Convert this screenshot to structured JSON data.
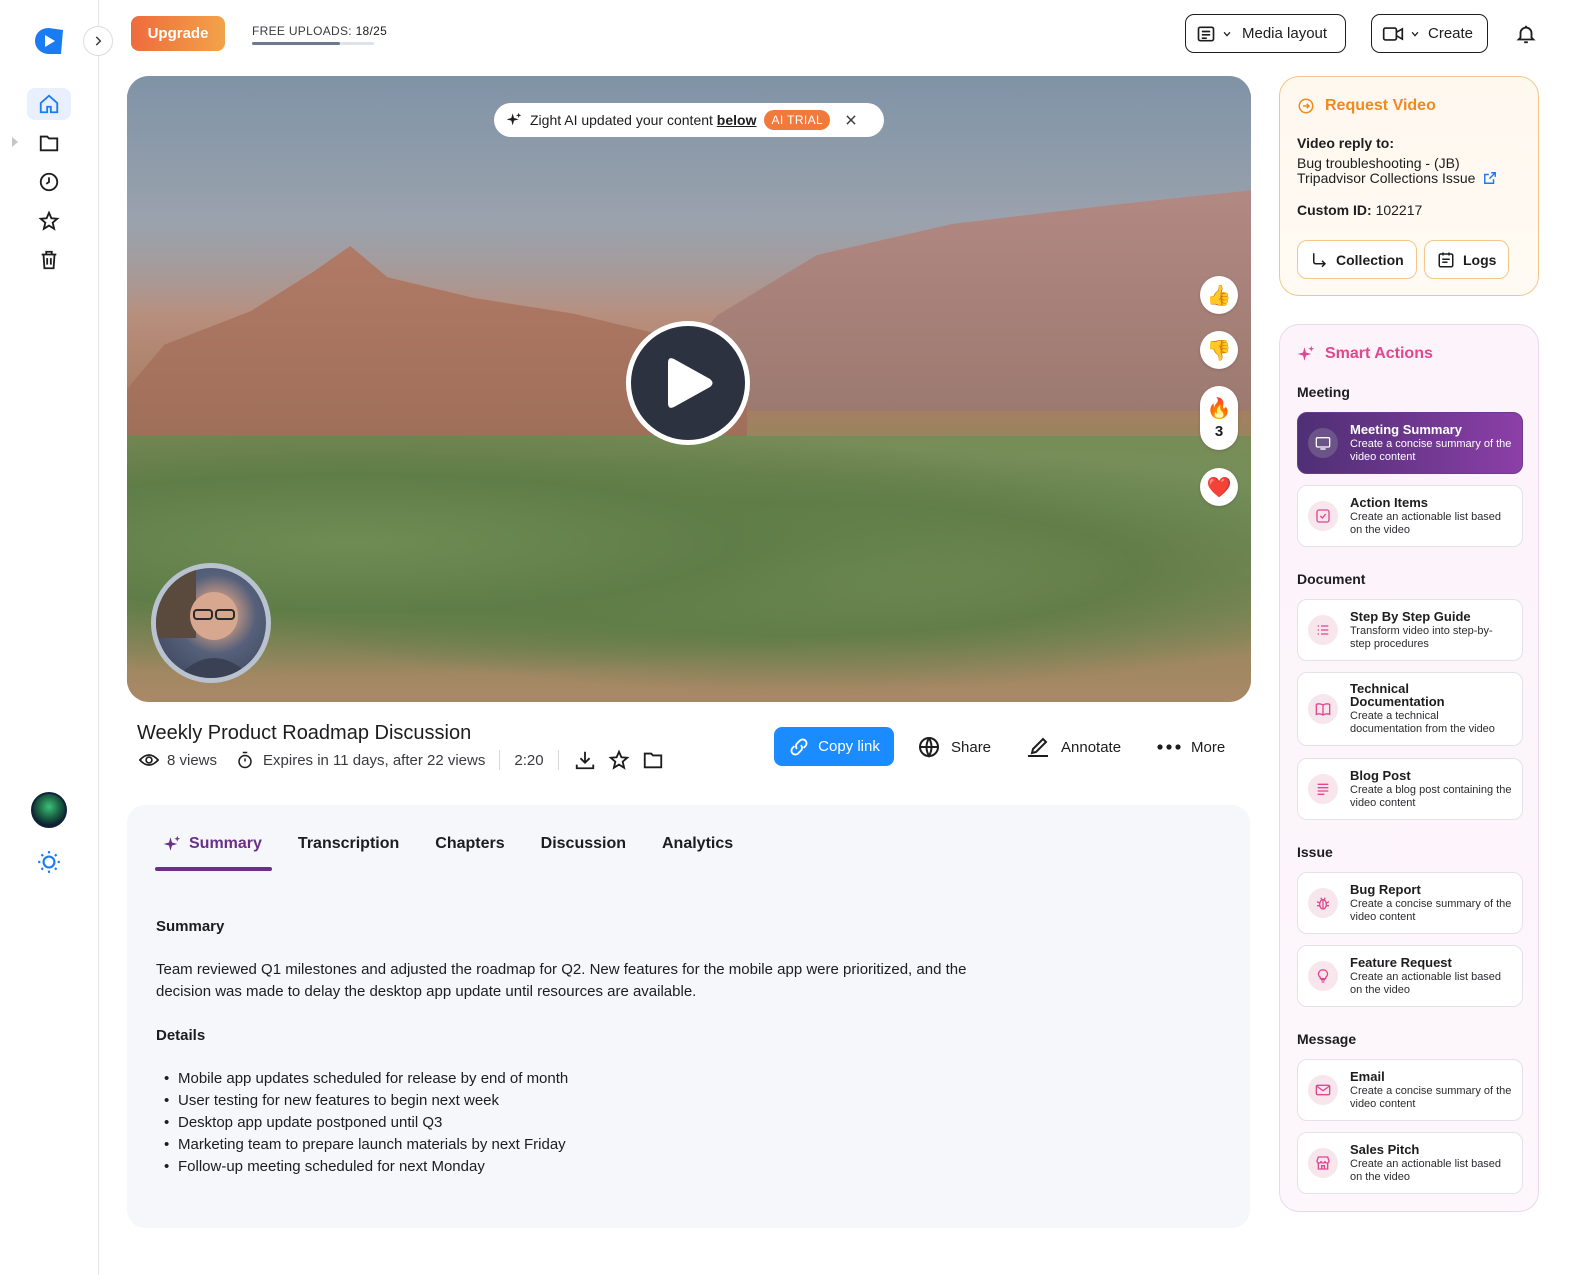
{
  "header": {
    "upgrade_label": "Upgrade",
    "uploads_label": "FREE UPLOADS:",
    "uploads_value": "18/25",
    "uploads_fraction": 0.72,
    "media_layout_label": "Media layout",
    "create_label": "Create"
  },
  "sidebar": {
    "items": [
      {
        "icon": "home-icon",
        "active": true
      },
      {
        "icon": "folder-icon"
      },
      {
        "icon": "clock-icon"
      },
      {
        "icon": "star-icon"
      },
      {
        "icon": "trash-icon"
      }
    ]
  },
  "video": {
    "ai_banner_text": "Zight AI updated your content",
    "ai_banner_link": "below",
    "ai_trial_badge": "AI TRIAL",
    "reactions": [
      {
        "emoji": "👍"
      },
      {
        "emoji": "👎"
      },
      {
        "emoji": "🔥",
        "count": "3"
      },
      {
        "emoji": "❤️"
      }
    ],
    "title": "Weekly Product Roadmap Discussion",
    "views": "8 views",
    "expires": "Expires in 11 days, after 22 views",
    "duration": "2:20"
  },
  "actions": {
    "copy_link": "Copy link",
    "share": "Share",
    "annotate": "Annotate",
    "more": "More"
  },
  "tabs": [
    "Summary",
    "Transcription",
    "Chapters",
    "Discussion",
    "Analytics"
  ],
  "summary": {
    "heading": "Summary",
    "text": "Team reviewed Q1 milestones and adjusted the roadmap for Q2. New features for the mobile app were prioritized, and the decision was made to delay the desktop app update until resources are available.",
    "details_heading": "Details",
    "details": [
      "Mobile app updates scheduled for release by end of month",
      "User testing for new features to begin next week",
      "Desktop app update postponed until Q3",
      "Marketing team to prepare launch materials by next Friday",
      "Follow-up meeting scheduled for next Monday"
    ]
  },
  "request": {
    "title": "Request Video",
    "reply_label": "Video reply to:",
    "reply_line1": "Bug troubleshooting - (JB)",
    "reply_line2": "Tripadvisor Collections Issue",
    "custom_id_label": "Custom ID:",
    "custom_id_value": "102217",
    "collection_btn": "Collection",
    "logs_btn": "Logs"
  },
  "smart_actions": {
    "title": "Smart Actions",
    "groups": {
      "meeting": "Meeting",
      "document": "Document",
      "issue": "Issue",
      "message": "Message"
    },
    "items": {
      "meeting_summary": {
        "name": "Meeting Summary",
        "desc": "Create a concise summary of the video content"
      },
      "action_items": {
        "name": "Action Items",
        "desc": "Create an actionable list based on the video"
      },
      "step_guide": {
        "name": "Step By Step Guide",
        "desc": "Transform video into step-by-step procedures"
      },
      "tech_doc": {
        "name": "Technical Documentation",
        "desc": "Create a technical documentation from the video"
      },
      "blog_post": {
        "name": "Blog Post",
        "desc": "Create a blog post containing the video content"
      },
      "bug_report": {
        "name": "Bug Report",
        "desc": "Create a concise summary of the video content"
      },
      "feature_request": {
        "name": "Feature Request",
        "desc": "Create an actionable list based on the video"
      },
      "email": {
        "name": "Email",
        "desc": "Create a concise summary of the video content"
      },
      "sales_pitch": {
        "name": "Sales Pitch",
        "desc": "Create an actionable list based on the video"
      }
    }
  },
  "colors": {
    "accent_blue": "#1a8cff",
    "summary_purple": "#6a2f86",
    "request_orange": "#f08a1c",
    "smart_pink": "#e0478f"
  }
}
